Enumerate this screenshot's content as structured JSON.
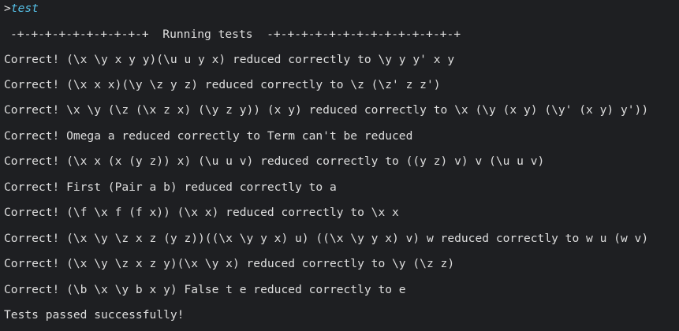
{
  "terminal": {
    "prompt": ">",
    "command": "test",
    "banner": "-+-+-+-+-+-+-+-+-+-+  Running tests  -+-+-+-+-+-+-+-+-+-+-+-+-+-+",
    "lines": [
      "Correct! (\\x \\y x y y)(\\u u y x) reduced correctly to \\y y y' x y",
      "Correct! (\\x x x)(\\y \\z y z) reduced correctly to \\z (\\z' z z')",
      "Correct! \\x \\y (\\z (\\x z x) (\\y z y)) (x y) reduced correctly to \\x (\\y (x y) (\\y' (x y) y'))",
      "Correct! Omega a reduced correctly to Term can't be reduced",
      "Correct! (\\x x (x (y z)) x) (\\u u v) reduced correctly to ((y z) v) v (\\u u v)",
      "Correct! First (Pair a b) reduced correctly to a",
      "Correct! (\\f \\x f (f x)) (\\x x) reduced correctly to \\x x",
      "Correct! (\\x \\y \\z x z (y z))((\\x \\y y x) u) ((\\x \\y y x) v) w reduced correctly to w u (w v)",
      "Correct! (\\x \\y \\z x z y)(\\x \\y x) reduced correctly to \\y (\\z z)",
      "Correct! (\\b \\x \\y b x y) False t e reduced correctly to e",
      "Tests passed successfully!"
    ]
  }
}
